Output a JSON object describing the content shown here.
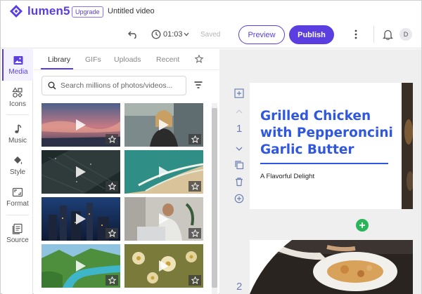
{
  "app": {
    "brand": "lumen5",
    "upgrade_label": "Upgrade",
    "doc_title": "Untitled video",
    "brand_color": "#5b3ee0"
  },
  "toolbar": {
    "undo_icon": "undo-icon",
    "duration": "01:03",
    "save_status": "Saved",
    "preview_label": "Preview",
    "publish_label": "Publish",
    "user_initial": "D"
  },
  "rail": {
    "items": [
      {
        "label": "Media",
        "icon": "image-icon",
        "active": true
      },
      {
        "label": "Icons",
        "icon": "shapes-icon"
      },
      {
        "label": "Music",
        "icon": "music-note-icon"
      },
      {
        "label": "Style",
        "icon": "paint-bucket-icon"
      },
      {
        "label": "Format",
        "icon": "aspect-ratio-icon"
      },
      {
        "label": "Source",
        "icon": "document-icon"
      }
    ]
  },
  "library": {
    "tabs": [
      "Library",
      "GIFs",
      "Uploads",
      "Recent"
    ],
    "active_tab": "Library",
    "search": {
      "placeholder": "Search millions of photos/videos...",
      "value": ""
    }
  },
  "canvas": {
    "scenes": [
      {
        "number": "1",
        "title": "Grilled Chicken with Pepperoncini Garlic Butter",
        "subtitle": "A Flavorful Delight"
      },
      {
        "number": "2"
      }
    ],
    "title_color": "#2f57e0",
    "add_scene_color": "#2bb45a"
  }
}
